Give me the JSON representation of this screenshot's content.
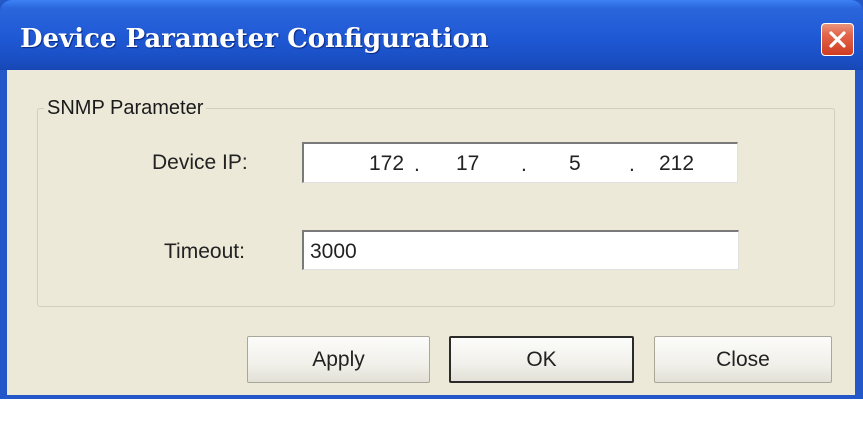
{
  "window": {
    "title": "Device Parameter Configuration",
    "close_icon": "close-x-icon",
    "title_bar_color": "#2457c8",
    "close_button_color": "#e3654a",
    "background_color": "#ece9d8"
  },
  "group": {
    "legend": "SNMP Parameter"
  },
  "device_ip": {
    "label": "Device IP:",
    "octets": [
      "172",
      "17",
      "5",
      "212"
    ],
    "separator": "."
  },
  "timeout": {
    "label": "Timeout:",
    "value": "3000"
  },
  "buttons": {
    "apply": "Apply",
    "ok": "OK",
    "close": "Close"
  }
}
